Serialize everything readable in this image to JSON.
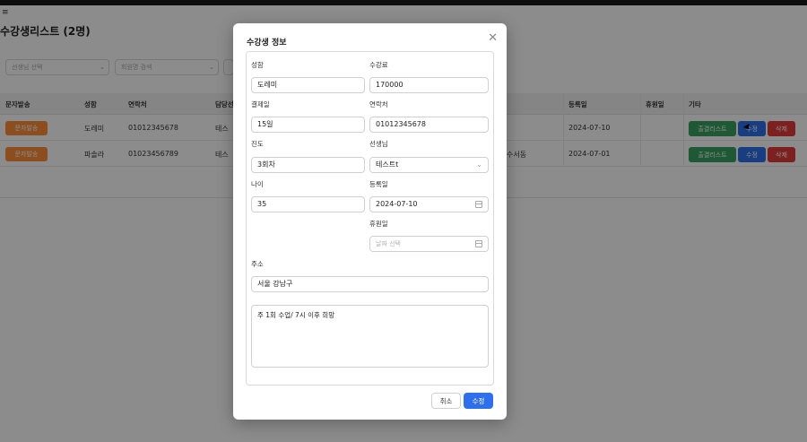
{
  "page": {
    "menu_glyph": "≡",
    "title": "수강생리스트 (2명)",
    "filters": [
      {
        "placeholder": "선생님 선택",
        "chevron": "⌄"
      },
      {
        "placeholder": "회원명 검색",
        "chevron": "⌄"
      }
    ]
  },
  "table": {
    "headers": [
      "문자발송",
      "성함",
      "연락처",
      "담당선",
      "등록일",
      "휴원일",
      "기타"
    ],
    "rows": [
      {
        "send": "문자발송",
        "name": "도레미",
        "phone": "01012345678",
        "teacher": "테스",
        "address": "",
        "date": "2024-07-10",
        "leave": "",
        "attend": "출결리스트",
        "edit": "수정",
        "delete": "삭제"
      },
      {
        "send": "문자발송",
        "name": "파솔라",
        "phone": "01023456789",
        "teacher": "테스",
        "address": "수서동",
        "date": "2024-07-01",
        "leave": "",
        "attend": "출결리스트",
        "edit": "수정",
        "delete": "삭제"
      }
    ]
  },
  "modal": {
    "title": "수강생 정보",
    "close": "✕",
    "fields": {
      "name": {
        "label": "성함",
        "value": "도레미"
      },
      "fee": {
        "label": "수강료",
        "value": "170000"
      },
      "payday": {
        "label": "결제일",
        "value": "15일"
      },
      "contact": {
        "label": "연락처",
        "value": "01012345678"
      },
      "progress": {
        "label": "진도",
        "value": "3회차"
      },
      "teacher": {
        "label": "선생님",
        "value": "테스트t",
        "chevron": "⌄"
      },
      "age": {
        "label": "나이",
        "value": "35"
      },
      "regdate": {
        "label": "등록일",
        "value": "2024-07-10"
      },
      "leave": {
        "label": "휴원일",
        "placeholder": "날짜 선택"
      },
      "address": {
        "label": "주소",
        "value": "서울 강남구"
      },
      "memo": {
        "value": "주 1회 수업/  7시 이후 희망"
      }
    },
    "cancel": "취소",
    "save": "수정"
  }
}
